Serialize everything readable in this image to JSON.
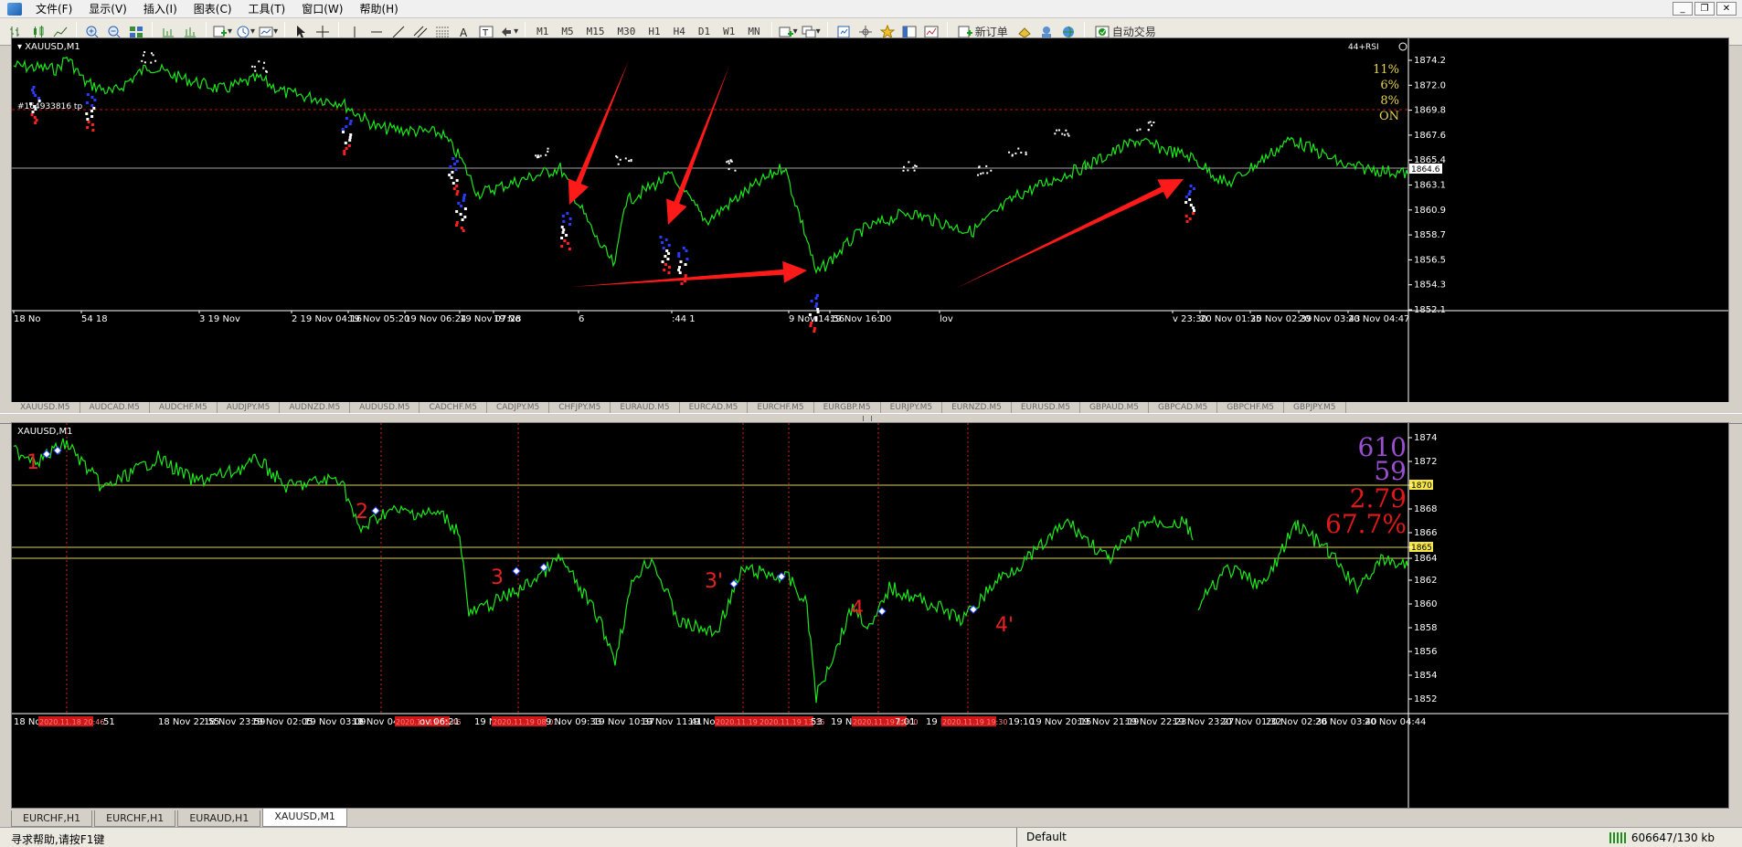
{
  "menu": {
    "items": [
      "文件(F)",
      "显示(V)",
      "插入(I)",
      "图表(C)",
      "工具(T)",
      "窗口(W)",
      "帮助(H)"
    ]
  },
  "toolbar": {
    "timeframes": [
      "M1",
      "M5",
      "M15",
      "M30",
      "H1",
      "H4",
      "D1",
      "W1",
      "MN"
    ],
    "new_order_label": "新订单",
    "auto_trade_label": "自动交易"
  },
  "top_chart": {
    "title": "XAUUSD,M1",
    "indicator_label": "44+RSI",
    "ticket_label": "#164933816 tp",
    "corner_text": [
      "11%",
      "6%",
      "8%",
      "ON"
    ],
    "corner_color": "#e8d44d",
    "price_ticks": [
      "1874.2",
      "1872.0",
      "1869.8",
      "1867.6",
      "1865.4",
      "1863.1",
      "1860.9",
      "1858.7",
      "1856.5",
      "1854.3",
      "1852.1"
    ],
    "current_price": "1864.6",
    "time_labels": [
      "18 No",
      "54  18",
      "3  19 Nov",
      "2  19 Nov 04:16",
      "19 Nov 05:20",
      "19 Nov 06:24",
      "19 Nov 07:28",
      "19 No",
      "6",
      ":44  1",
      "9 Nov 14:56",
      "19 Nov 16:00",
      "1",
      "lov",
      "v 23:30",
      "20 Nov 01:35",
      "20 Nov 02:39",
      "20 Nov 03:43",
      "20 Nov 04:47"
    ],
    "line_color": "#1ee61e",
    "arrow_color": "#ff1a1a"
  },
  "bottom_chart": {
    "title": "XAUUSD,M1",
    "stats": [
      {
        "text": "610",
        "color": "#9a4fd0"
      },
      {
        "text": "59",
        "color": "#9a4fd0"
      },
      {
        "text": "2.79",
        "color": "#e01818"
      },
      {
        "text": "67.7%",
        "color": "#e01818"
      }
    ],
    "price_ticks": [
      "1874",
      "1872",
      "1870",
      "1868",
      "1866",
      "1865",
      "1864",
      "1862",
      "1860",
      "1858",
      "1856",
      "1854",
      "1852"
    ],
    "highlight_ticks": [
      "1870",
      "1865"
    ],
    "annotations": [
      "1",
      "2",
      "3",
      "3'",
      "4",
      "4'"
    ],
    "time_labels": [
      "18 Nov",
      "2020.11.18 20:46",
      "51",
      "18 Nov 22:55",
      "18 Nov 23:59",
      "19 Nov 02:05",
      "19 Nov 03:09",
      "19 Nov 04:13",
      "1",
      "2020.11.19 05:46",
      "ov 06:21",
      "19 Nov 07:25",
      "2020.11.19 08:01",
      "9 Nov 09:33",
      "19 Nov 10:37",
      "19 Nov 11:41",
      "19 Nov 1",
      "2020.11.19 12:50",
      "2020.11.19 13:35",
      "53",
      "19 No",
      "2020.11.19 17:00",
      "7:01",
      "19 M",
      "2020.11.19 19:30",
      "19:10",
      "19 Nov 20:15",
      "19 Nov 21:19",
      "19 Nov 22:23",
      "19 Nov 23:27",
      "20 Nov 01:32",
      "20 Nov 02:36",
      "20 Nov 03:40",
      "20 Nov 04:44"
    ],
    "line_color": "#1ee61e"
  },
  "symbol_strip": [
    "XAUUSD.M5",
    "AUDCAD.M5",
    "AUDCHF.M5",
    "AUDJPY.M5",
    "AUDNZD.M5",
    "AUDUSD.M5",
    "CADCHF.M5",
    "CADJPY.M5",
    "CHFJPY.M5",
    "EURAUD.M5",
    "EURCAD.M5",
    "EURCHF.M5",
    "EURGBP.M5",
    "EURJPY.M5",
    "EURNZD.M5",
    "EURUSD.M5",
    "GBPAUD.M5",
    "GBPCAD.M5",
    "GBPCHF.M5",
    "GBPJPY.M5"
  ],
  "chart_tabs": [
    {
      "label": "EURCHF,H1",
      "active": false
    },
    {
      "label": "EURCHF,H1",
      "active": false
    },
    {
      "label": "EURAUD,H1",
      "active": false
    },
    {
      "label": "XAUUSD,M1",
      "active": true
    }
  ],
  "status": {
    "help": "寻求帮助,请按F1键",
    "profile": "Default",
    "traffic": "606647/130 kb"
  }
}
